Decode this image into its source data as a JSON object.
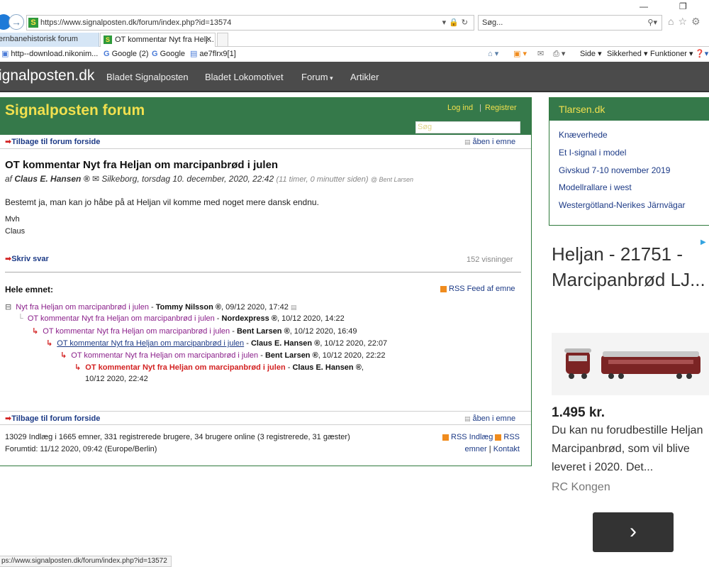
{
  "browser": {
    "url": "https://www.signalposten.dk/forum/index.php?id=13574",
    "search_placeholder": "Søg...",
    "tabs": [
      {
        "label": "ernbanehistorisk forum"
      },
      {
        "label": "OT kommentar Nyt fra Helj..."
      }
    ],
    "favorites": [
      {
        "label": "http--download.nikonim..."
      },
      {
        "label": "Google (2)"
      },
      {
        "label": "Google"
      },
      {
        "label": "ae7flrx9[1]"
      }
    ],
    "tools": {
      "side": "Side",
      "sikkerhed": "Sikkerhed",
      "funktioner": "Funktioner"
    },
    "status_url": "ps://www.signalposten.dk/forum/index.php?id=13572"
  },
  "site": {
    "brand": "ignalposten.dk",
    "nav": [
      "Bladet Signalposten",
      "Bladet Lokomotivet",
      "Forum",
      "Artikler"
    ]
  },
  "forum": {
    "title": "Signalposten forum",
    "login": "Log ind",
    "separator": "|",
    "register": "Registrer",
    "search_placeholder": "Søg",
    "back_link": "Tilbage til forum forside",
    "open_topic": "åben i emne",
    "post": {
      "title": "OT kommentar Nyt fra Heljan om marcipanbrød i julen",
      "by_prefix": "af",
      "author": "Claus E. Hansen ®",
      "location_date": "Silkeborg, torsdag 10. december, 2020, 22:42",
      "ago": "(11 timer, 0 minutter siden)",
      "reply_to": "@ Bent Larsen",
      "body": "Bestemt ja, man kan jo håbe på at Heljan vil komme med noget mere dansk endnu.",
      "sign_line1": "Mvh",
      "sign_line2": "Claus",
      "reply_label": "Skriv svar",
      "views": "152 visninger"
    },
    "thread_heading": "Hele emnet:",
    "rss_feed": "RSS Feed af emne",
    "thread": [
      {
        "title": "Nyt fra Heljan om marcipanbrød i julen",
        "author": "Tommy Nilsson ®",
        "date": ", 09/12 2020, 17:42"
      },
      {
        "title": "OT kommentar Nyt fra Heljan om marcipanbrød i julen",
        "author": "Nordexpress ®",
        "date": ", 10/12 2020, 14:22"
      },
      {
        "title": "OT kommentar Nyt fra Heljan om marcipanbrød i julen",
        "author": "Bent Larsen ®",
        "date": ", 10/12 2020, 16:49"
      },
      {
        "title": "OT kommentar Nyt fra Heljan om marcipanbrød i julen",
        "author": "Claus E. Hansen ®",
        "date": ", 10/12 2020, 22:07"
      },
      {
        "title": "OT kommentar Nyt fra Heljan om marcipanbrød i julen",
        "author": "Bent Larsen ®",
        "date": ", 10/12 2020, 22:22"
      },
      {
        "title": "OT kommentar Nyt fra Heljan om marcipanbrød i julen",
        "author": "Claus E. Hansen ®",
        "date": ",",
        "date2": "10/12 2020, 22:42"
      }
    ],
    "thread_sep": " - ",
    "stats": "13029 Indlæg i 1665 emner, 331 registrerede brugere, 34 brugere online (3 registrerede, 31 gæster)",
    "forum_time": "Forumtid: 11/12 2020, 09:42 (Europe/Berlin)",
    "rss_posts": "RSS Indlæg",
    "rss": "RSS",
    "topics": "emner",
    "contact": "Kontakt",
    "pipe": "|"
  },
  "sidebar": {
    "title": "Tlarsen.dk",
    "items": [
      "Knæverhede",
      "Et I-signal i model",
      "Givskud 7-10 november 2019",
      "Modellrallare i west",
      "Westergötland-Nerikes Järnvägar"
    ]
  },
  "ad": {
    "title": "Heljan - 21751 - Marcipanbrød LJ...",
    "price": "1.495 kr.",
    "description": "Du kan nu forudbestille Heljan Marcipanbrød, som vil blive leveret i 2020. Det...",
    "seller": "RC Kongen",
    "button_arrow": "›"
  },
  "colors": {
    "forum_green": "#35794a",
    "header_yellow": "#f1e04e",
    "link_blue": "#1c3a86",
    "visited_purple": "#8a1f8a",
    "current_red": "#d32222",
    "nav_grey": "#4b4b4b"
  }
}
